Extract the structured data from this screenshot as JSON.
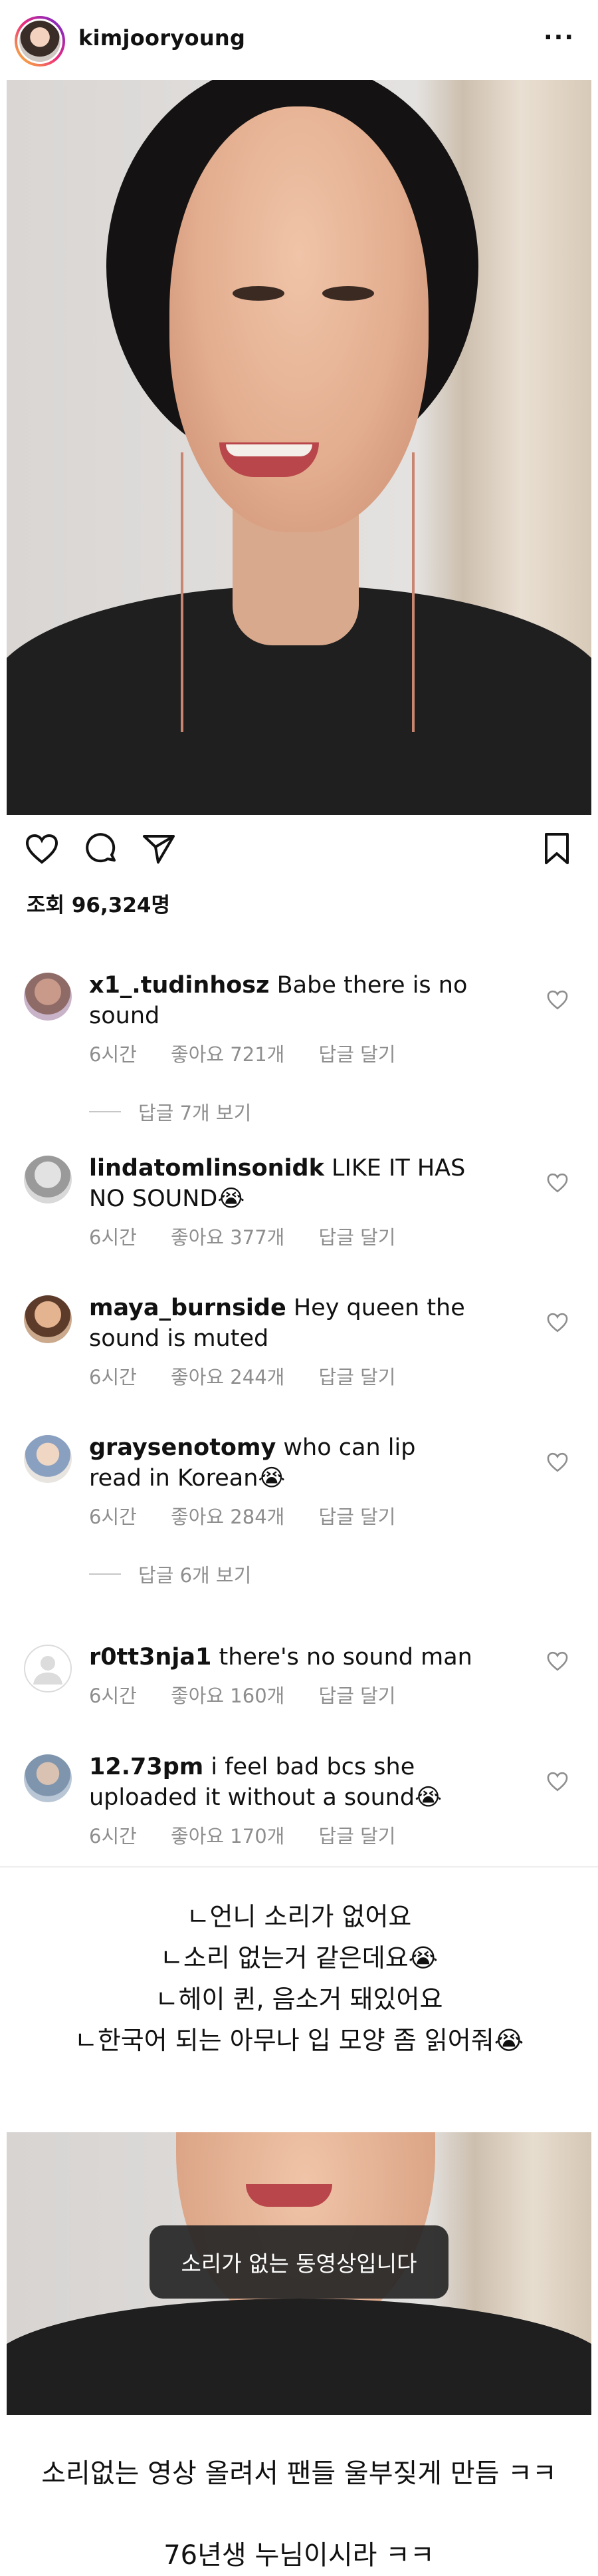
{
  "header": {
    "username": "kimjooryoung",
    "more_icon": "more-dots-icon",
    "more_label": "···"
  },
  "post": {
    "views_label": "조회 96,324명",
    "actions": [
      "heart-icon",
      "comment-icon",
      "share-icon",
      "bookmark-icon"
    ]
  },
  "comments": [
    {
      "username": "x1_.tudinhosz",
      "text": "Babe there is no sound",
      "time": "6시간",
      "likes": "좋아요 721개",
      "reply": "답글 달기",
      "view_replies": "답글 7개 보기"
    },
    {
      "username": "lindatomlinsonidk",
      "text": "LIKE IT HAS NO SOUND😭",
      "time": "6시간",
      "likes": "좋아요 377개",
      "reply": "답글 달기"
    },
    {
      "username": "maya_burnside",
      "text": "Hey queen the sound is muted",
      "time": "6시간",
      "likes": "좋아요 244개",
      "reply": "답글 달기"
    },
    {
      "username": "graysenotomy",
      "text": "who can lip read in Korean😭",
      "time": "6시간",
      "likes": "좋아요 284개",
      "reply": "답글 달기",
      "view_replies": "답글 6개 보기"
    },
    {
      "username": "r0tt3nja1",
      "text": "there's no sound man",
      "time": "6시간",
      "likes": "좋아요 160개",
      "reply": "답글 달기"
    },
    {
      "username": "12.73pm",
      "text": "i feel bad bcs she uploaded it without a sound😭",
      "time": "6시간",
      "likes": "좋아요 170개",
      "reply": "답글 달기"
    }
  ],
  "translation": [
    "ㄴ언니 소리가 없어요",
    "ㄴ소리 없는거 같은데요😭",
    "ㄴ헤이 퀸, 음소거 돼있어요",
    "ㄴ한국어 되는 아무나 입 모양 좀 읽어줘😭"
  ],
  "video": {
    "toast": "소리가 없는 동영상입니다"
  },
  "footer": {
    "line1": "소리없는 영상 올려서 팬들 울부짖게 만듬 ㅋㅋ",
    "line2": "76년생 누님이시라 ㅋㅋ"
  }
}
